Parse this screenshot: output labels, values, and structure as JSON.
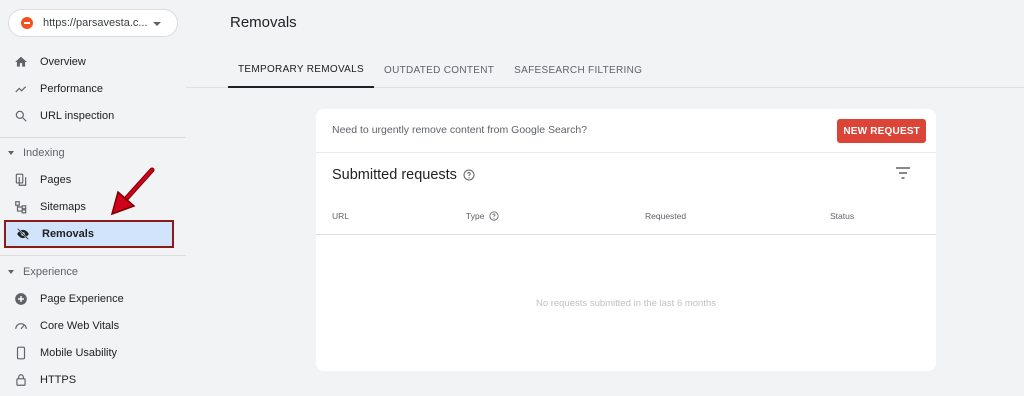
{
  "property": {
    "url": "https://parsavesta.c..."
  },
  "sidebar": {
    "top_items": [
      {
        "label": "Overview",
        "icon": "home-icon"
      },
      {
        "label": "Performance",
        "icon": "trending-up-icon"
      },
      {
        "label": "URL inspection",
        "icon": "search-icon"
      }
    ],
    "sections": [
      {
        "title": "Indexing",
        "items": [
          {
            "label": "Pages",
            "icon": "pages-icon"
          },
          {
            "label": "Sitemaps",
            "icon": "sitemap-icon"
          },
          {
            "label": "Removals",
            "icon": "eye-off-icon",
            "active": true
          }
        ]
      },
      {
        "title": "Experience",
        "items": [
          {
            "label": "Page Experience",
            "icon": "plus-circle-icon"
          },
          {
            "label": "Core Web Vitals",
            "icon": "gauge-icon"
          },
          {
            "label": "Mobile Usability",
            "icon": "phone-icon"
          },
          {
            "label": "HTTPS",
            "icon": "lock-icon"
          }
        ]
      }
    ]
  },
  "main": {
    "title": "Removals",
    "tabs": [
      {
        "label": "TEMPORARY REMOVALS",
        "active": true
      },
      {
        "label": "OUTDATED CONTENT"
      },
      {
        "label": "SAFESEARCH FILTERING"
      }
    ],
    "card": {
      "prompt": "Need to urgently remove content from Google Search?",
      "new_request_label": "NEW REQUEST",
      "submitted_title": "Submitted requests",
      "columns": [
        "URL",
        "Type",
        "Requested",
        "Status"
      ],
      "empty_message": "No requests submitted in the last 6 months"
    }
  },
  "colors": {
    "accent_button": "#db4437",
    "active_nav_bg": "#d2e3fc",
    "highlight_border": "#8b1a1a",
    "arrow": "#d0021b"
  }
}
